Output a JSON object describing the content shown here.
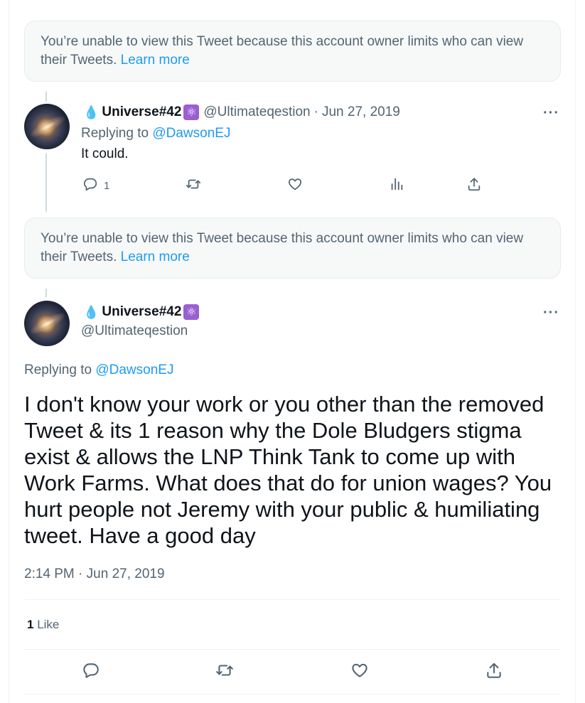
{
  "notices": [
    {
      "text": "You’re unable to view this Tweet because this account owner limits who can view their Tweets.",
      "link": "Learn more"
    },
    {
      "text": "You’re unable to view this Tweet because this account owner limits who can view their Tweets.",
      "link": "Learn more"
    }
  ],
  "reply_tweet": {
    "name": "Universe#42",
    "name_prefix_emoji": "💧",
    "badge_emoji": "⚛",
    "handle": "@Ultimateqestion",
    "separator": "·",
    "date": "Jun 27, 2019",
    "more": "···",
    "replying_prefix": "Replying to",
    "replying_to": "@DawsonEJ",
    "text": "It could.",
    "reply_count": "1"
  },
  "main_tweet": {
    "name": "Universe#42",
    "name_prefix_emoji": "💧",
    "badge_emoji": "⚛",
    "handle": "@Ultimateqestion",
    "more": "···",
    "replying_prefix": "Replying to",
    "replying_to": "@DawsonEJ",
    "text": "I don't know your work or you other than the removed Tweet & its 1 reason why the Dole Bludgers stigma exist & allows the LNP Think Tank to come up with Work Farms. What does that do for union wages? You hurt people not Jeremy with your public & humiliating tweet. Have a good day",
    "time": "2:14 PM",
    "separator": "·",
    "date": "Jun 27, 2019",
    "like_count": "1",
    "like_label": "Like"
  },
  "icons": {
    "reply": "reply-icon",
    "retweet": "retweet-icon",
    "like": "heart-icon",
    "views": "views-icon",
    "share": "share-icon"
  },
  "colors": {
    "link": "#1d9bf0",
    "secondary_text": "#536471",
    "primary_text": "#0f1419",
    "notice_bg": "#f7f9f9",
    "badge": "#9a5fd1"
  }
}
